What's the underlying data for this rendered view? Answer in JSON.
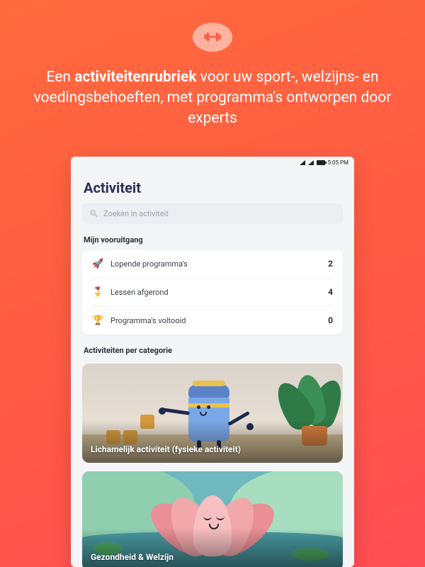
{
  "promo": {
    "icon": "dumbbell-icon",
    "headline_pre": "Een ",
    "headline_bold": "activiteitenrubriek",
    "headline_post": " voor uw sport-, welzijns- en voedingsbehoeften, met programma's ontworpen door experts"
  },
  "statusbar": {
    "time": "5:05 PM"
  },
  "page": {
    "title": "Activiteit",
    "search_placeholder": "Zoeken in activiteit"
  },
  "progress": {
    "section_label": "Mijn vooruitgang",
    "rows": [
      {
        "icon": "🚀",
        "label": "Lopende programma's",
        "value": "2"
      },
      {
        "icon": "🎖️",
        "label": "Lessen afgerond",
        "value": "4"
      },
      {
        "icon": "🏆",
        "label": "Programma's voltooid",
        "value": "0"
      }
    ]
  },
  "categories": {
    "section_label": "Activiteiten per categorie",
    "items": [
      {
        "title": "Lichamelijk activiteit (fysieke activiteit)"
      },
      {
        "title": "Gezondheid & Welzijn"
      }
    ]
  },
  "colors": {
    "accent": "#ff5a44",
    "title": "#2a2f5b"
  }
}
